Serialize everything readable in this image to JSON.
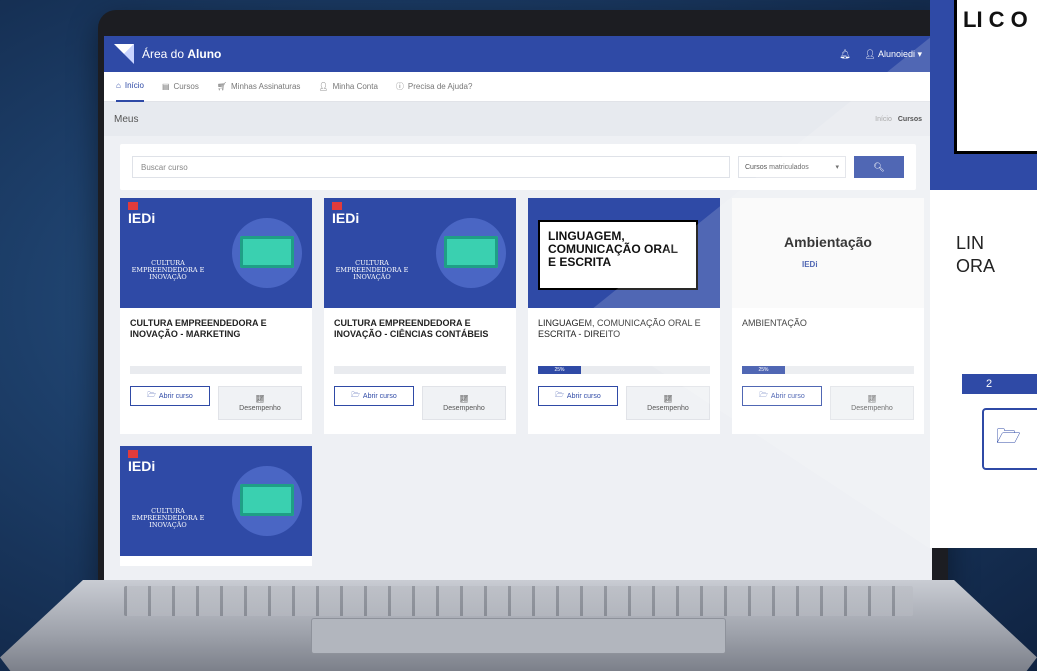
{
  "topbar": {
    "app_prefix": "Área do",
    "app_name": "Aluno",
    "user": "Alunoiedi"
  },
  "nav": [
    {
      "label": "Início",
      "active": true
    },
    {
      "label": "Cursos"
    },
    {
      "label": "Minhas Assinaturas"
    },
    {
      "label": "Minha Conta"
    },
    {
      "label": "Precisa de Ajuda?"
    }
  ],
  "page": {
    "heading": "Meus",
    "crumb_home": "Início",
    "crumb_current": "Cursos"
  },
  "search": {
    "placeholder": "Buscar curso",
    "filter_value": "Cursos matriculados"
  },
  "courses": [
    {
      "brand": "IEDi",
      "blurb": "CULTURA EMPREENDEDORA E INOVAÇÃO",
      "title": "CULTURA EMPREENDEDORA E INOVAÇÃO - MARKETING",
      "progress_pct": 0
    },
    {
      "brand": "IEDi",
      "blurb": "CULTURA EMPREENDEDORA E INOVAÇÃO",
      "title": "CULTURA EMPREENDEDORA E INOVAÇÃO - CIÊNCIAS CONTÁBEIS",
      "progress_pct": 0
    },
    {
      "panel": "LINGUAGEM, COMUNICAÇÃO ORAL E ESCRITA",
      "title": "LINGUAGEM, COMUNICAÇÃO ORAL E ESCRITA - DIREITO",
      "progress_pct": 25,
      "progress_label": "25%"
    },
    {
      "word": "Ambientação",
      "brand_small": "IEDi",
      "title": "AMBIENTAÇÃO",
      "progress_pct": 25,
      "progress_label": "25%"
    },
    {
      "brand": "IEDi",
      "blurb": "CULTURA EMPREENDEDORA E INOVAÇÃO"
    }
  ],
  "actions": {
    "open": "Abrir curso",
    "performance": "Desempenho"
  },
  "zoom": {
    "panel": "LI C O",
    "title_l1": "LIN",
    "title_l2": "ORA",
    "progress": "2"
  },
  "colors": {
    "brand_blue": "#2f4aa6",
    "accent_red": "#e23b3b"
  }
}
